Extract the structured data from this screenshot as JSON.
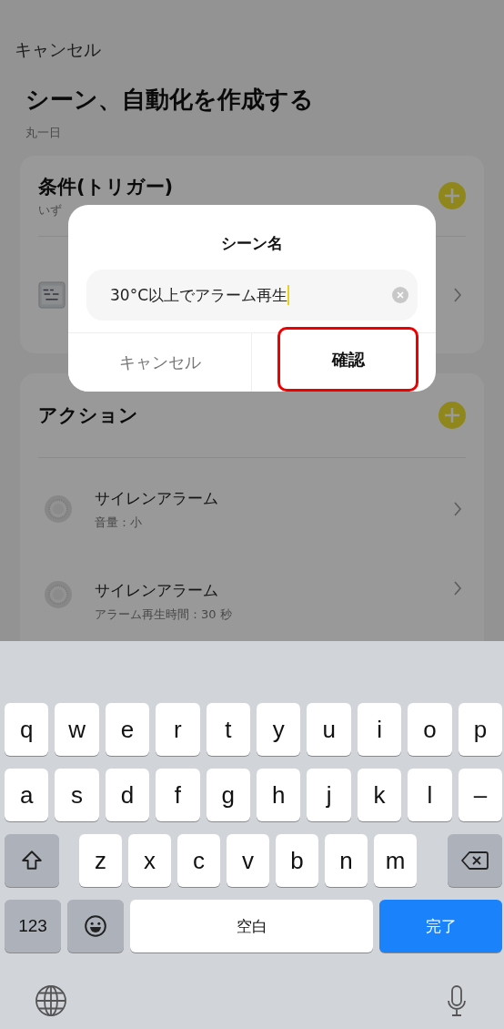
{
  "header": {
    "cancel": "キャンセル",
    "title": "シーン、自動化を作成する",
    "subtitle": "丸一日"
  },
  "conditions": {
    "title": "条件(トリガー)",
    "hint": "いず"
  },
  "actions": {
    "title": "アクション",
    "items": [
      {
        "name": "サイレンアラーム",
        "detail": "音量：小"
      },
      {
        "name": "サイレンアラーム",
        "detail": "アラーム再生時間：30 秒"
      }
    ]
  },
  "dialog": {
    "title": "シーン名",
    "value": "30°C以上でアラーム再生",
    "buttons": [
      {
        "label": "キャンセル",
        "kind": "cancel",
        "highlighted": false
      },
      {
        "label": "確認",
        "kind": "confirm",
        "highlighted": true
      }
    ]
  },
  "keyboard": {
    "rows": [
      [
        "q",
        "w",
        "e",
        "r",
        "t",
        "y",
        "u",
        "i",
        "o",
        "p"
      ],
      [
        "a",
        "s",
        "d",
        "f",
        "g",
        "h",
        "j",
        "k",
        "l",
        "–"
      ],
      [
        "z",
        "x",
        "c",
        "v",
        "b",
        "n",
        "m"
      ]
    ],
    "numbers": "123",
    "space": "空白",
    "done": "完了"
  }
}
